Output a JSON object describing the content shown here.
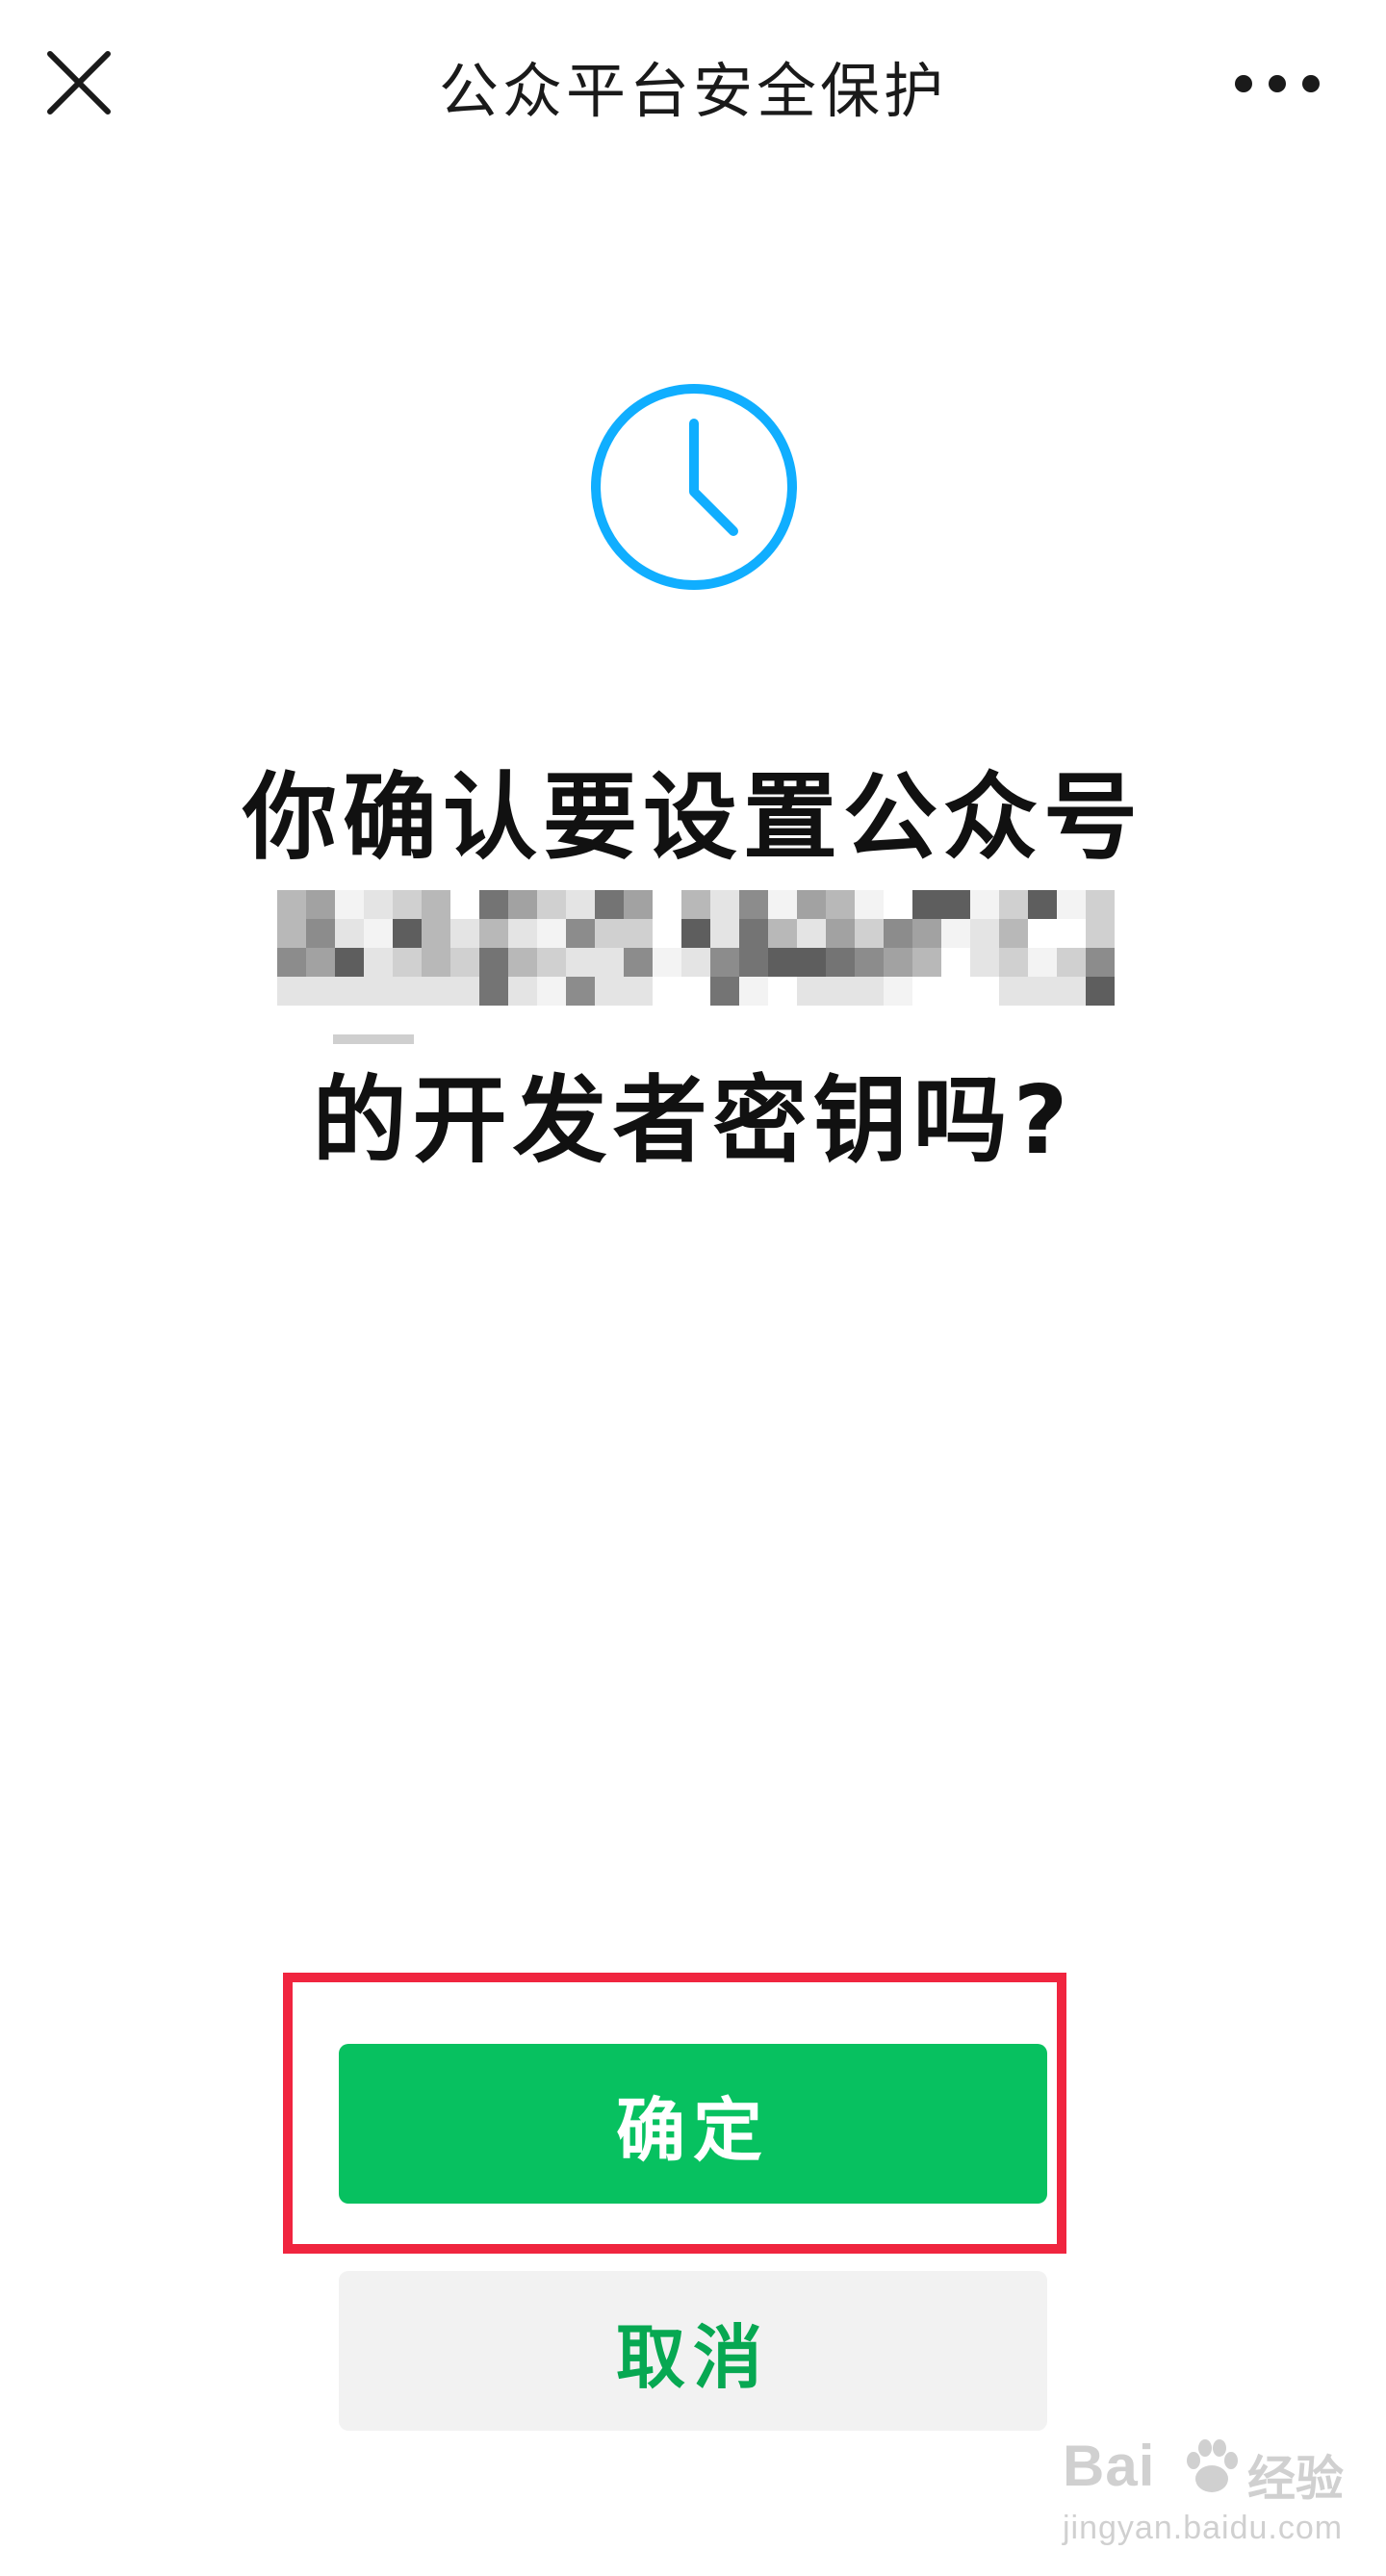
{
  "header": {
    "title": "公众平台安全保护",
    "close_icon": "close-icon",
    "more_icon": "more-icon"
  },
  "status": {
    "icon": "clock-icon",
    "color": "#10aeff"
  },
  "prompt": {
    "line1": "你确认要设置公众号",
    "line2": "的开发者密钥吗?"
  },
  "actions": {
    "confirm_label": "确定",
    "cancel_label": "取消",
    "confirm_color": "#07c160",
    "highlight_color": "#f0253f"
  },
  "watermark": {
    "brand": "Bai",
    "label": "经验",
    "url": "jingyan.baidu.com"
  }
}
